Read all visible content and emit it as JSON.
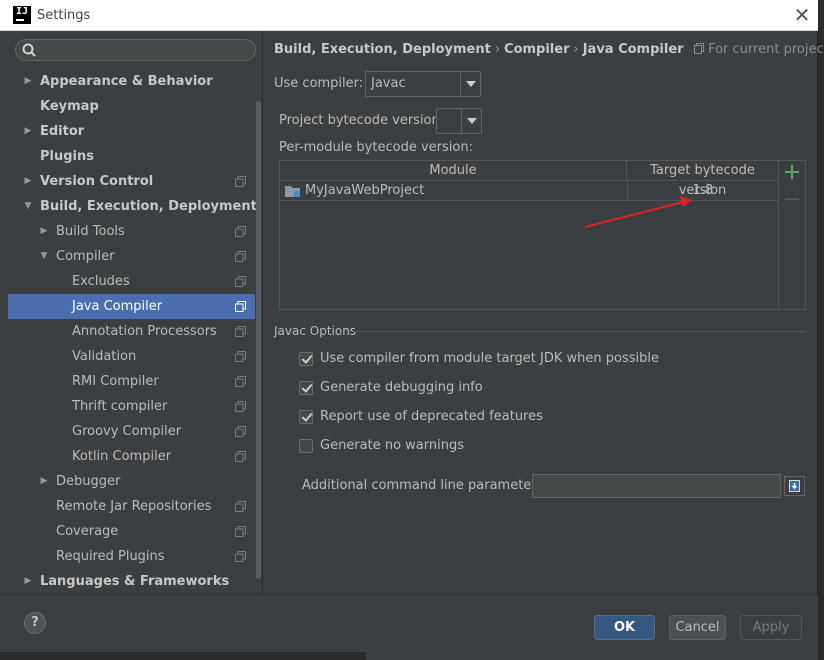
{
  "window": {
    "title": "Settings",
    "app_logo": "IJ",
    "close_glyph": "✕"
  },
  "search": {
    "placeholder": ""
  },
  "tree": [
    {
      "label": "Appearance & Behavior",
      "level": 0,
      "arrow": "▶",
      "bold": true,
      "copy": false
    },
    {
      "label": "Keymap",
      "level": 0,
      "arrow": "",
      "bold": true,
      "copy": false
    },
    {
      "label": "Editor",
      "level": 0,
      "arrow": "▶",
      "bold": true,
      "copy": false
    },
    {
      "label": "Plugins",
      "level": 0,
      "arrow": "",
      "bold": true,
      "copy": false
    },
    {
      "label": "Version Control",
      "level": 0,
      "arrow": "▶",
      "bold": true,
      "copy": true
    },
    {
      "label": "Build, Execution, Deployment",
      "level": 0,
      "arrow": "▼",
      "bold": true,
      "copy": false
    },
    {
      "label": "Build Tools",
      "level": 1,
      "arrow": "▶",
      "bold": false,
      "copy": true
    },
    {
      "label": "Compiler",
      "level": 1,
      "arrow": "▼",
      "bold": false,
      "copy": true
    },
    {
      "label": "Excludes",
      "level": 2,
      "arrow": "",
      "bold": false,
      "copy": true
    },
    {
      "label": "Java Compiler",
      "level": 2,
      "arrow": "",
      "bold": false,
      "copy": true,
      "selected": true
    },
    {
      "label": "Annotation Processors",
      "level": 2,
      "arrow": "",
      "bold": false,
      "copy": true
    },
    {
      "label": "Validation",
      "level": 2,
      "arrow": "",
      "bold": false,
      "copy": true
    },
    {
      "label": "RMI Compiler",
      "level": 2,
      "arrow": "",
      "bold": false,
      "copy": true
    },
    {
      "label": "Thrift compiler",
      "level": 2,
      "arrow": "",
      "bold": false,
      "copy": true
    },
    {
      "label": "Groovy Compiler",
      "level": 2,
      "arrow": "",
      "bold": false,
      "copy": true
    },
    {
      "label": "Kotlin Compiler",
      "level": 2,
      "arrow": "",
      "bold": false,
      "copy": true
    },
    {
      "label": "Debugger",
      "level": 1,
      "arrow": "▶",
      "bold": false,
      "copy": false
    },
    {
      "label": "Remote Jar Repositories",
      "level": 1,
      "arrow": "",
      "bold": false,
      "copy": true
    },
    {
      "label": "Coverage",
      "level": 1,
      "arrow": "",
      "bold": false,
      "copy": true
    },
    {
      "label": "Required Plugins",
      "level": 1,
      "arrow": "",
      "bold": false,
      "copy": true
    },
    {
      "label": "Languages & Frameworks",
      "level": 0,
      "arrow": "▶",
      "bold": true,
      "copy": false
    }
  ],
  "breadcrumb": {
    "parts": [
      "Build, Execution, Deployment",
      "Compiler",
      "Java Compiler"
    ],
    "separator": "›",
    "scope": "For current project"
  },
  "compiler": {
    "use_compiler_label": "Use compiler:",
    "use_compiler_value": "Javac",
    "bytecode_label": "Project bytecode version:",
    "bytecode_value": "",
    "per_module_label": "Per-module bytecode version:"
  },
  "module_table": {
    "headers": [
      "Module",
      "Target bytecode version"
    ],
    "rows": [
      {
        "module": "MyJavaWebProject",
        "version": "1.8"
      }
    ]
  },
  "javac_options": {
    "title": "Javac Options",
    "checkboxes": [
      {
        "label": "Use compiler from module target JDK when possible",
        "checked": true
      },
      {
        "label": "Generate debugging info",
        "checked": true
      },
      {
        "label": "Report use of deprecated features",
        "checked": true
      },
      {
        "label": "Generate no warnings",
        "checked": false
      }
    ],
    "params_label": "Additional command line parameters:",
    "params_value": ""
  },
  "footer": {
    "help": "?",
    "ok": "OK",
    "cancel": "Cancel",
    "apply": "Apply"
  },
  "colors": {
    "selection": "#4b6eaf",
    "ok_button": "#365880",
    "add_icon": "#59a869",
    "annotation_arrow": "#e02020"
  }
}
